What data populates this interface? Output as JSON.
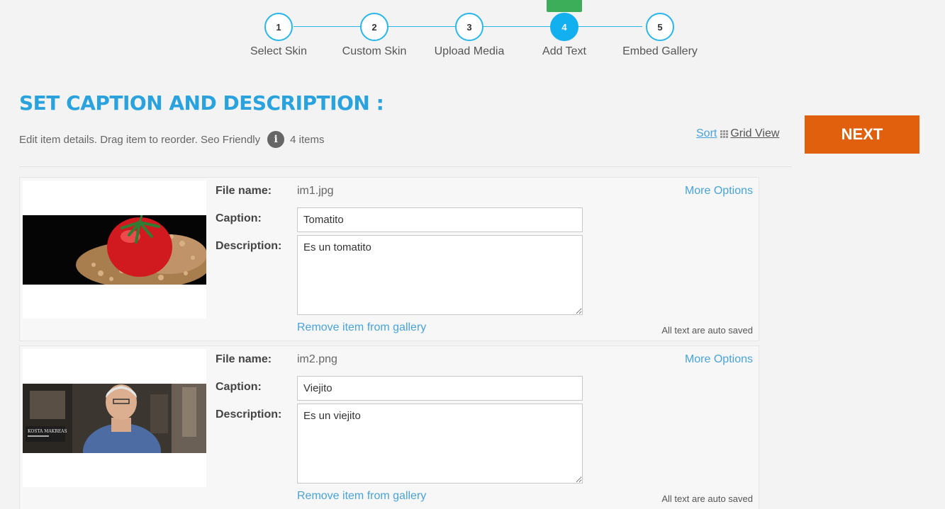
{
  "stepper": {
    "steps": [
      {
        "number": "1",
        "label": "Select Skin"
      },
      {
        "number": "2",
        "label": "Custom Skin"
      },
      {
        "number": "3",
        "label": "Upload Media"
      },
      {
        "number": "4",
        "label": "Add Text"
      },
      {
        "number": "5",
        "label": "Embed Gallery"
      }
    ],
    "active_step": 4
  },
  "header": {
    "title": "SET CAPTION AND DESCRIPTION :",
    "subtitle": "Edit item details. Drag item to reorder. Seo Friendly",
    "info_icon": "i",
    "item_count": "4 items",
    "sort_label": "Sort",
    "grid_view_label": "Grid View",
    "next_label": "NEXT"
  },
  "labels": {
    "file_name": "File name:",
    "caption": "Caption:",
    "description": "Description:",
    "more_options": "More Options",
    "remove": "Remove item from gallery",
    "auto_saved": "All text are auto saved"
  },
  "items": [
    {
      "file_name": "im1.jpg",
      "caption": "Tomatito",
      "description": "Es un tomatito",
      "thumbnail": "tomato-image"
    },
    {
      "file_name": "im2.png",
      "caption": "Viejito",
      "description": "Es un viejito",
      "thumbnail": "old-man-video-image",
      "thumbnail_caption": "KOSTA MAKREAS"
    }
  ],
  "colors": {
    "accent": "#29a2dd",
    "next_button": "#e0600e",
    "active_step": "#12b0ee",
    "active_flag": "#3cae5a"
  }
}
